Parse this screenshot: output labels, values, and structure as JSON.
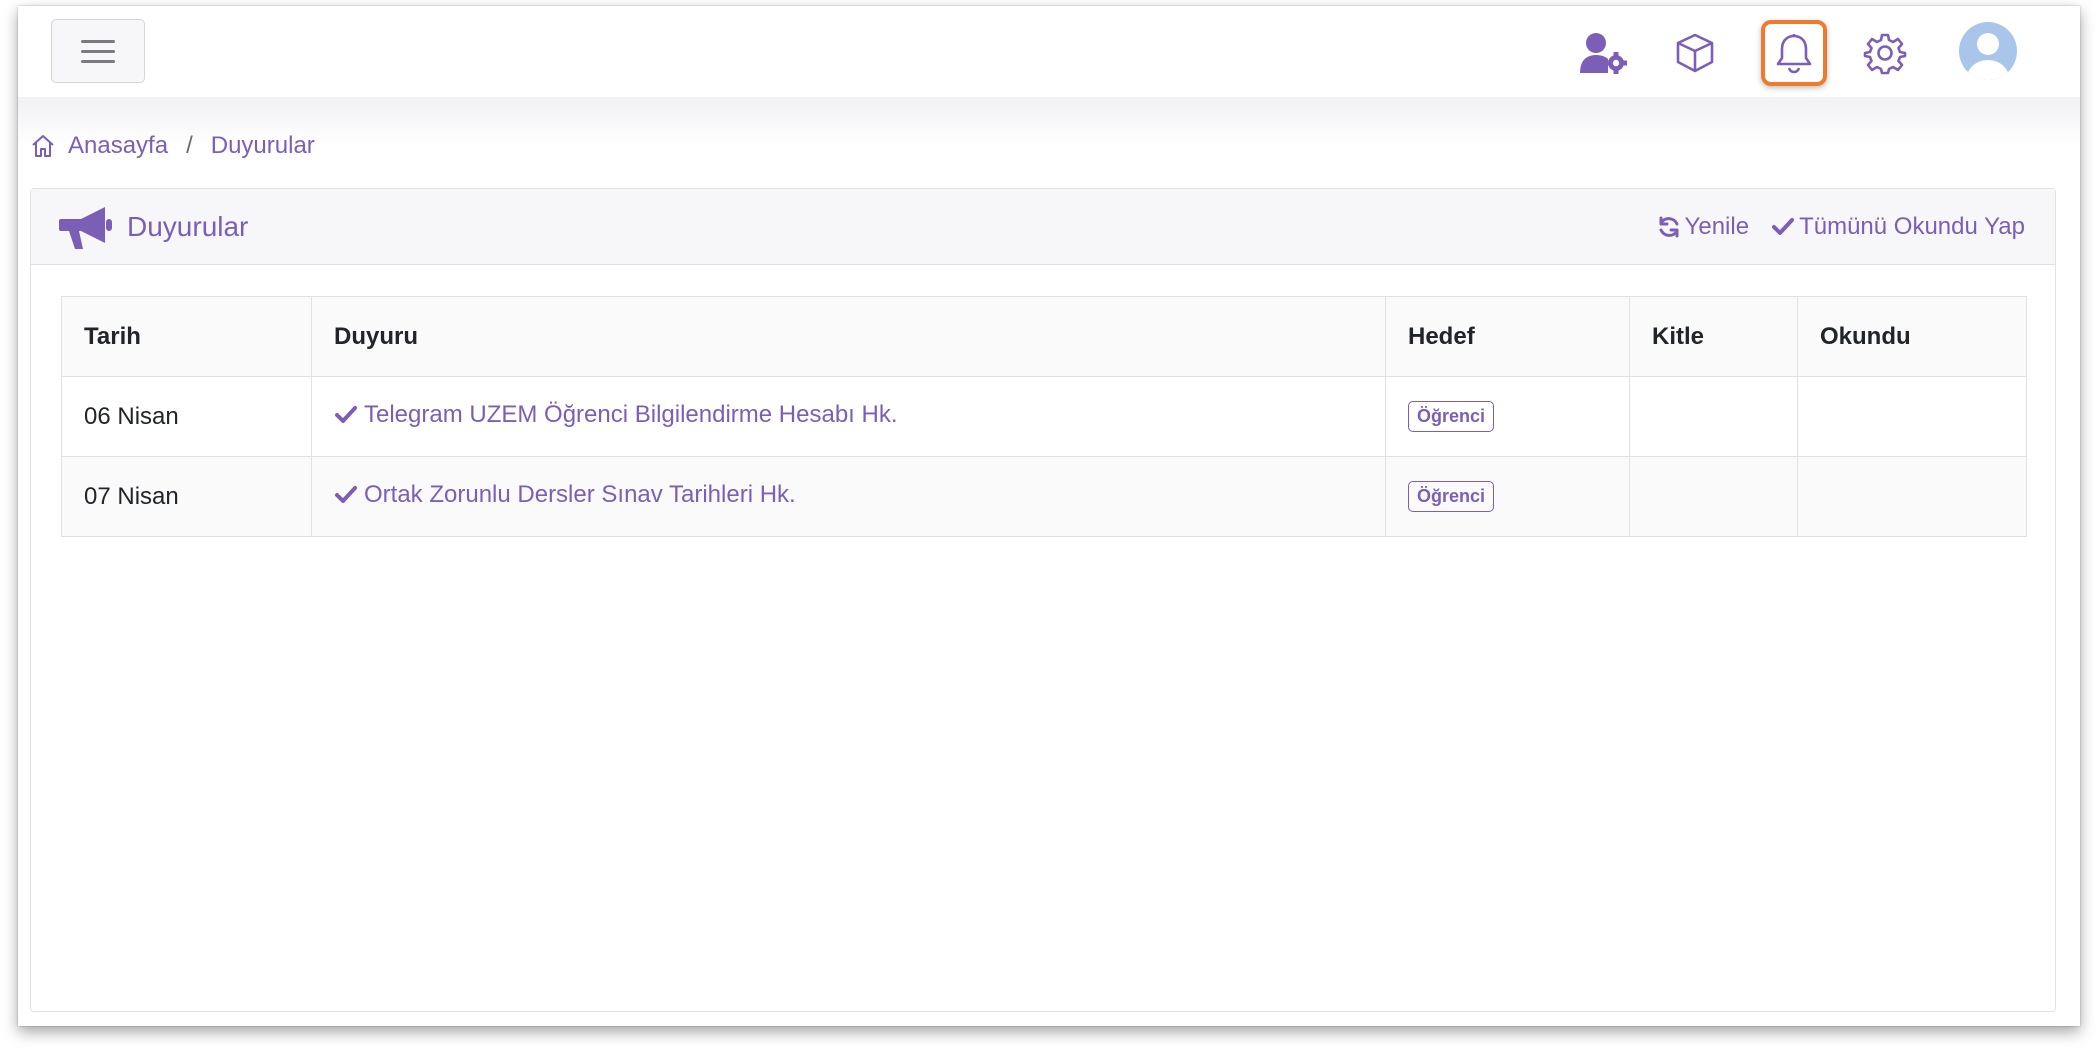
{
  "colors": {
    "accent": "#7b5fb7",
    "highlight": "#ee7a2f"
  },
  "topbar": {
    "icons": [
      "user-gear-icon",
      "box-icon",
      "bell-icon",
      "gear-icon",
      "avatar"
    ]
  },
  "breadcrumb": {
    "home": "Anasayfa",
    "separator": "/",
    "current": "Duyurular"
  },
  "card": {
    "title": "Duyurular",
    "refresh_label": "Yenile",
    "mark_all_label": "Tümünü Okundu Yap"
  },
  "table": {
    "headers": [
      "Tarih",
      "Duyuru",
      "Hedef",
      "Kitle",
      "Okundu"
    ],
    "rows": [
      {
        "date": "06 Nisan",
        "title": "Telegram UZEM Öğrenci Bilgilendirme Hesabı Hk.",
        "target": "Öğrenci",
        "audience": "",
        "read": ""
      },
      {
        "date": "07 Nisan",
        "title": "Ortak Zorunlu Dersler Sınav Tarihleri Hk.",
        "target": "Öğrenci",
        "audience": "",
        "read": ""
      }
    ]
  }
}
